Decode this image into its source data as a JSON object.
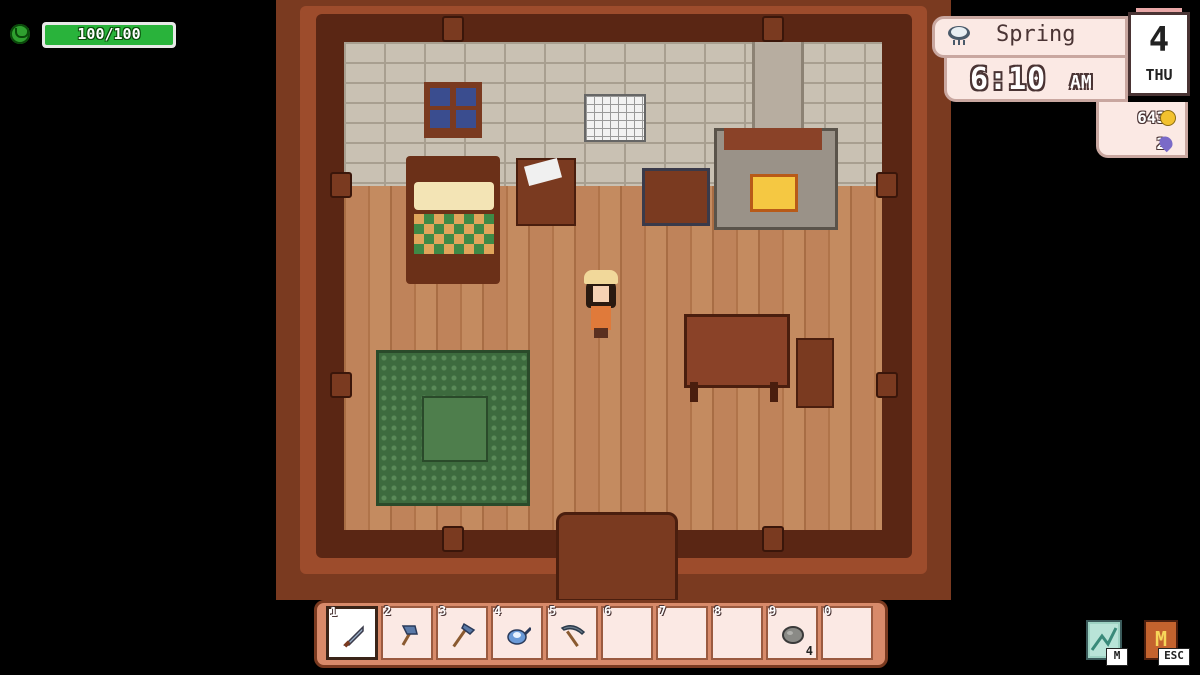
{
  "hud": {
    "energy": {
      "text": "100/100",
      "fraction": 1.0,
      "icon": "energy-face-icon",
      "color": "#29b33b"
    },
    "season": "Spring",
    "weather_icon": "cloudy-rain-icon",
    "time": "6:10",
    "ampm": "AM",
    "date": {
      "day": "4",
      "weekday": "THU"
    },
    "gold": "643",
    "gold_icon": "gold-coin-icon",
    "essence": "2",
    "essence_icon": "essence-drop-icon"
  },
  "hotbar": {
    "slots": [
      {
        "num": "1",
        "icon": "sword-icon",
        "count": "",
        "active": true
      },
      {
        "num": "2",
        "icon": "axe-icon",
        "count": "",
        "active": false
      },
      {
        "num": "3",
        "icon": "hoe-icon",
        "count": "",
        "active": false
      },
      {
        "num": "4",
        "icon": "watering-can-icon",
        "count": "",
        "active": false
      },
      {
        "num": "5",
        "icon": "pickaxe-icon",
        "count": "",
        "active": false
      },
      {
        "num": "6",
        "icon": "",
        "count": "",
        "active": false
      },
      {
        "num": "7",
        "icon": "",
        "count": "",
        "active": false
      },
      {
        "num": "8",
        "icon": "",
        "count": "",
        "active": false
      },
      {
        "num": "9",
        "icon": "stone-icon",
        "count": "4",
        "active": false
      },
      {
        "num": "0",
        "icon": "",
        "count": "",
        "active": false
      }
    ]
  },
  "buttons": {
    "map_key": "M",
    "menu_key": "ESC",
    "menu_glyph": "M"
  }
}
